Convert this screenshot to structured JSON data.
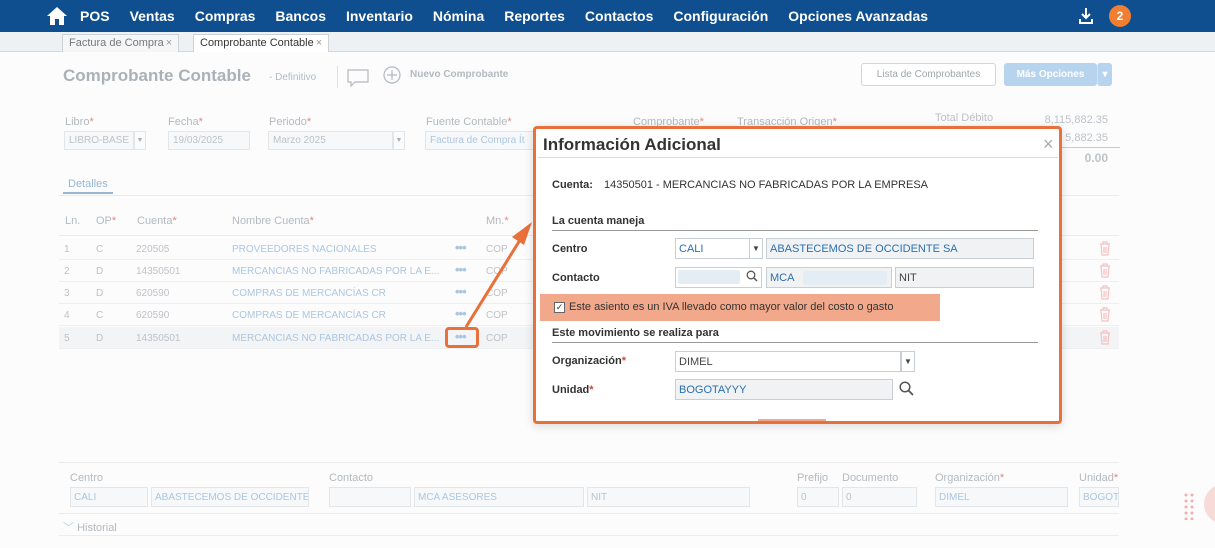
{
  "nav": {
    "items": [
      "POS",
      "Ventas",
      "Compras",
      "Bancos",
      "Inventario",
      "Nómina",
      "Reportes",
      "Contactos",
      "Configuración",
      "Opciones Avanzadas"
    ],
    "notifications": "2",
    "bg_color": "#0f4f8f",
    "badge_color": "#f07f33"
  },
  "tabs": [
    {
      "label": "Factura de Compra",
      "close": "×"
    },
    {
      "label": "Comprobante Contable",
      "close": "×"
    }
  ],
  "header": {
    "title": "Comprobante Contable",
    "subtitle": "- Definitivo",
    "new_label": "Nuevo Comprobante",
    "list_button": "Lista de Comprobantes",
    "more_button": "Más Opciones"
  },
  "fields": {
    "libro": {
      "label": "Libro",
      "value": "LIBRO-BASE"
    },
    "fecha": {
      "label": "Fecha",
      "value": "19/03/2025"
    },
    "periodo": {
      "label": "Periodo",
      "value": "Marzo 2025"
    },
    "fuente": {
      "label": "Fuente Contable",
      "value": "Factura de Compra Ít"
    },
    "comprobante": {
      "label": "Comprobante"
    },
    "transaccion": {
      "label": "Transacción Origen"
    }
  },
  "totals": {
    "debit_label": "Total Débito",
    "debit_value": "8,115,882.35",
    "credit_value": "5,882.35",
    "diff_value": "0.00"
  },
  "details": {
    "tab": "Detalles",
    "columns": {
      "ln": "Ln.",
      "op": "OP",
      "cuenta": "Cuenta",
      "nombre": "Nombre Cuenta",
      "mn": "Mn."
    },
    "rows": [
      {
        "ln": "1",
        "op": "C",
        "cuenta": "220505",
        "nombre": "PROVEEDORES NACIONALES",
        "mn": "COP"
      },
      {
        "ln": "2",
        "op": "D",
        "cuenta": "14350501",
        "nombre": "MERCANCIAS NO FABRICADAS POR LA E...",
        "mn": "COP"
      },
      {
        "ln": "3",
        "op": "D",
        "cuenta": "620590",
        "nombre": "COMPRAS DE MERCANCÍAS CR",
        "mn": "COP"
      },
      {
        "ln": "4",
        "op": "C",
        "cuenta": "620590",
        "nombre": "COMPRAS DE MERCANCÍAS CR",
        "mn": "COP"
      },
      {
        "ln": "5",
        "op": "D",
        "cuenta": "14350501",
        "nombre": "MERCANCIAS NO FABRICADAS POR LA E...",
        "mn": "COP"
      }
    ],
    "dots": "•••"
  },
  "bottom": {
    "centro_label": "Centro",
    "centro_code": "CALI",
    "centro_name": "ABASTECEMOS DE OCCIDENTE",
    "contacto_label": "Contacto",
    "contacto_name": "MCA ASESORES",
    "contacto_type": "NIT",
    "prefijo_label": "Prefijo",
    "prefijo_value": "0",
    "documento_label": "Documento",
    "documento_value": "0",
    "org_label": "Organización",
    "org_value": "DIMEL",
    "unidad_label": "Unidad",
    "unidad_value": "BOGOTA",
    "historial": "Historial"
  },
  "modal": {
    "title": "Información Adicional",
    "close": "×",
    "cuenta_label": "Cuenta:",
    "cuenta_value": "14350501 - MERCANCIAS NO FABRICADAS POR LA EMPRESA",
    "section_maneja": "La cuenta maneja",
    "centro_label": "Centro",
    "centro_code": "CALI",
    "centro_name": "ABASTECEMOS DE OCCIDENTE SA",
    "contacto_label": "Contacto",
    "contacto_name": "MCA",
    "contacto_type": "NIT",
    "iva_text": "Este asiento es un IVA llevado como mayor valor del costo o gasto",
    "iva_checked": true,
    "section_mov": "Este movimiento se realiza para",
    "org_label": "Organización",
    "org_value": "DIMEL",
    "unidad_label": "Unidad",
    "unidad_value": "BOGOTAYYY",
    "accent_color": "#e8703a"
  }
}
